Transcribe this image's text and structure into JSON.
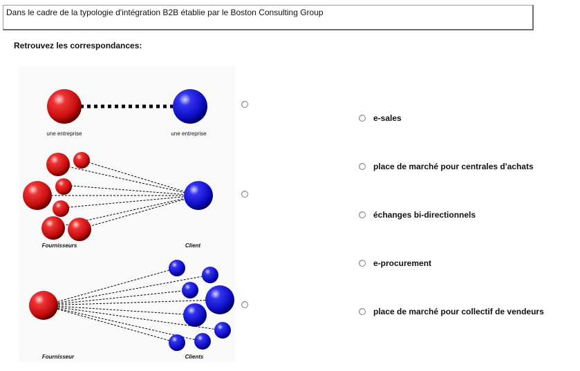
{
  "question": {
    "text": "Dans le cadre de la typologie d'intégration B2B établie par le Boston Consulting Group"
  },
  "instruction": "Retrouvez les correspondances:",
  "figures": [
    {
      "caption_left": "une entreprise",
      "caption_right": "une entreprise"
    },
    {
      "caption_left": "Fournisseurs",
      "caption_right": "Client"
    },
    {
      "caption_left": "Fournisseur",
      "caption_right": "Clients"
    }
  ],
  "answers": [
    {
      "label": "e-sales"
    },
    {
      "label": "place de marché pour centrales d'achats"
    },
    {
      "label": "échanges bi-directionnels"
    },
    {
      "label": "e-procurement"
    },
    {
      "label": "place de marché pour collectif de vendeurs"
    }
  ],
  "colors": {
    "supplier_sphere": "#cc1111",
    "client_sphere": "#1111cc"
  }
}
